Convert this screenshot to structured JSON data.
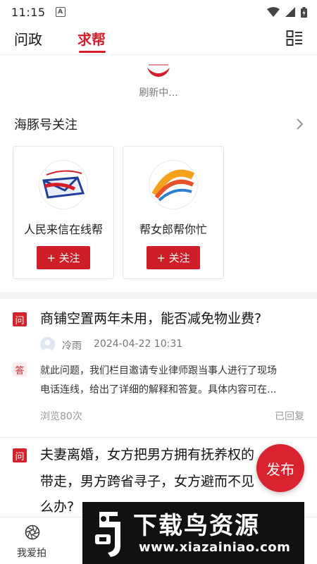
{
  "status_bar": {
    "time": "11:15",
    "notification_letter": "A"
  },
  "tabs": [
    {
      "label": "问政",
      "active": false
    },
    {
      "label": "求帮",
      "active": true
    }
  ],
  "refresh": {
    "text": "刷新中..."
  },
  "follow_section": {
    "title": "海豚号关注",
    "cards": [
      {
        "name": "人民来信在线帮",
        "button": "+ 关注"
      },
      {
        "name": "帮女郎帮你忙",
        "button": "+ 关注"
      }
    ]
  },
  "posts": [
    {
      "q_badge": "问",
      "title_lines": [
        "商铺空置两年未用，能否减免物业费?"
      ],
      "author": "冷雨",
      "time": "2024-04-22 10:31",
      "a_badge": "答",
      "answer_lines": [
        "就此问题，我们栏目邀请专业律师跟当事人进行了现场",
        "电话连线，给出了详细的解释和答复。具体内容可在..."
      ],
      "views": "浏览80次",
      "status": "已回复"
    },
    {
      "q_badge": "问",
      "title_lines": [
        "夫妻离婚，女方把男方拥有抚养权的",
        "带走，男方跨省寻子，女方避而不见",
        "么办?"
      ]
    }
  ],
  "fab": {
    "label": "发布"
  },
  "bottom_nav": [
    {
      "label": "我爱拍",
      "icon": "aperture-icon"
    },
    {
      "label": "我",
      "icon": "user-icon"
    }
  ],
  "watermark": {
    "title": "下载鸟资源",
    "url": "www.xiazainiao.com"
  },
  "colors": {
    "accent": "#d21f2a"
  }
}
